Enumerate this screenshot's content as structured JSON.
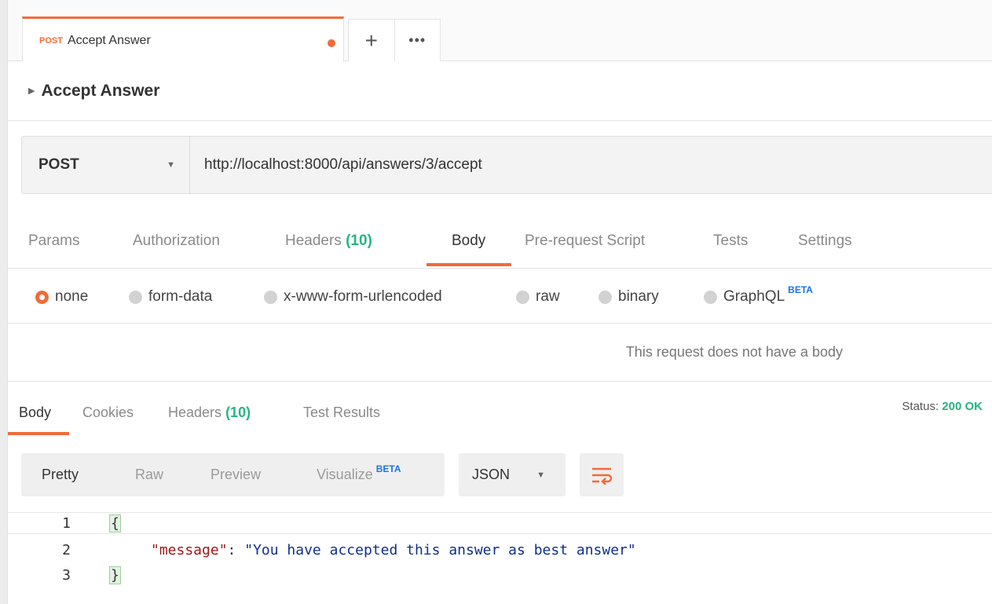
{
  "tab": {
    "method": "POST",
    "name": "Accept Answer"
  },
  "request": {
    "title": "Accept Answer",
    "method": "POST",
    "url": "http://localhost:8000/api/answers/3/accept"
  },
  "request_tabs": {
    "params": "Params",
    "authorization": "Authorization",
    "headers": "Headers",
    "headers_count": "(10)",
    "body": "Body",
    "prerequest": "Pre-request Script",
    "tests": "Tests",
    "settings": "Settings"
  },
  "body_types": {
    "none": "none",
    "form_data": "form-data",
    "urlencoded": "x-www-form-urlencoded",
    "raw": "raw",
    "binary": "binary",
    "graphql": "GraphQL",
    "beta": "BETA"
  },
  "no_body_message": "This request does not have a body",
  "response_tabs": {
    "body": "Body",
    "cookies": "Cookies",
    "headers": "Headers",
    "headers_count": "(10)",
    "test_results": "Test Results"
  },
  "status": {
    "label": "Status:",
    "value": "200 OK"
  },
  "format": {
    "pretty": "Pretty",
    "raw": "Raw",
    "preview": "Preview",
    "visualize": "Visualize",
    "beta": "BETA",
    "language": "JSON"
  },
  "code": {
    "line_numbers": [
      "1",
      "2",
      "3"
    ],
    "open_brace": "{",
    "key": "\"message\"",
    "colon": ": ",
    "value": "\"You have accepted this answer as best answer\"",
    "close_brace": "}"
  },
  "colors": {
    "accent": "#f26b3a",
    "success": "#26b47f",
    "beta": "#1a73e8"
  }
}
